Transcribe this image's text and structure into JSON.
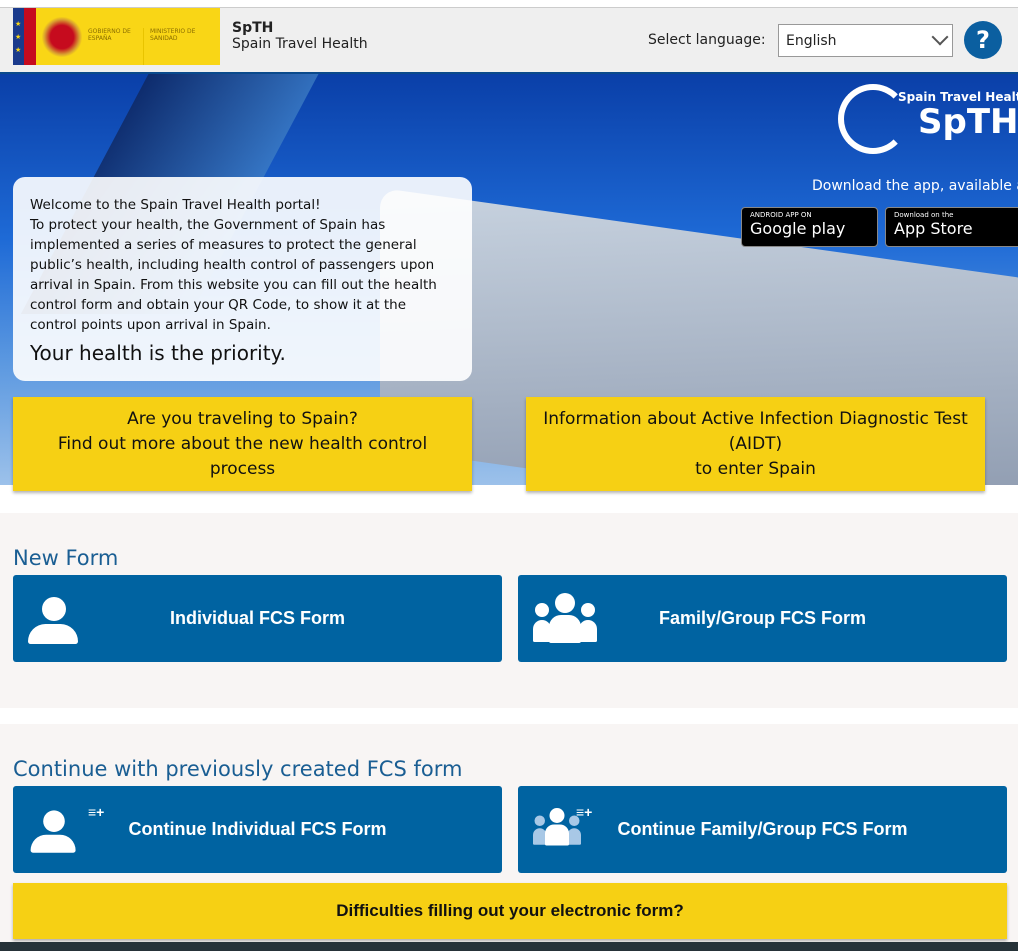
{
  "header": {
    "gov_logo_text": [
      "GOBIERNO DE ESPAÑA",
      "MINISTERIO DE SANIDAD"
    ],
    "app_short": "SpTH",
    "app_name": "Spain Travel Health",
    "language_label": "Select language:",
    "language_value": "English",
    "help_label": "?"
  },
  "hero": {
    "logo_text": "Spain Travel Health SpTH",
    "download_text": "Download the app, available at",
    "google_play": {
      "small": "ANDROID APP ON",
      "big": "Google play"
    },
    "app_store": {
      "small": "Download on the",
      "big": "App Store"
    },
    "welcome_title": "Welcome to the Spain Travel Health portal!",
    "welcome_body": "To protect your health, the Government of Spain has implemented a series of measures to protect the general public’s health, including health control of passengers upon arrival in Spain. From this website you can fill out the health control form and obtain your QR Code, to show it at the control points upon arrival in Spain.",
    "priority": "Your health is the priority.",
    "btn_travel": [
      "Are you traveling to Spain?",
      "Find out more about the new health control process"
    ],
    "btn_aidt": [
      "Information about Active Infection Diagnostic Test (AIDT)",
      "to enter Spain"
    ]
  },
  "new_form": {
    "title": "New Form",
    "individual": "Individual FCS Form",
    "group": "Family/Group FCS Form"
  },
  "continue_form": {
    "title": "Continue with previously created FCS form",
    "individual": "Continue Individual FCS Form",
    "group": "Continue Family/Group FCS Form"
  },
  "difficulties": "Difficulties filling out your electronic form?",
  "colors": {
    "primary_blue": "#0063a1",
    "accent_yellow": "#f6d014",
    "heading_blue": "#1a5e93"
  }
}
